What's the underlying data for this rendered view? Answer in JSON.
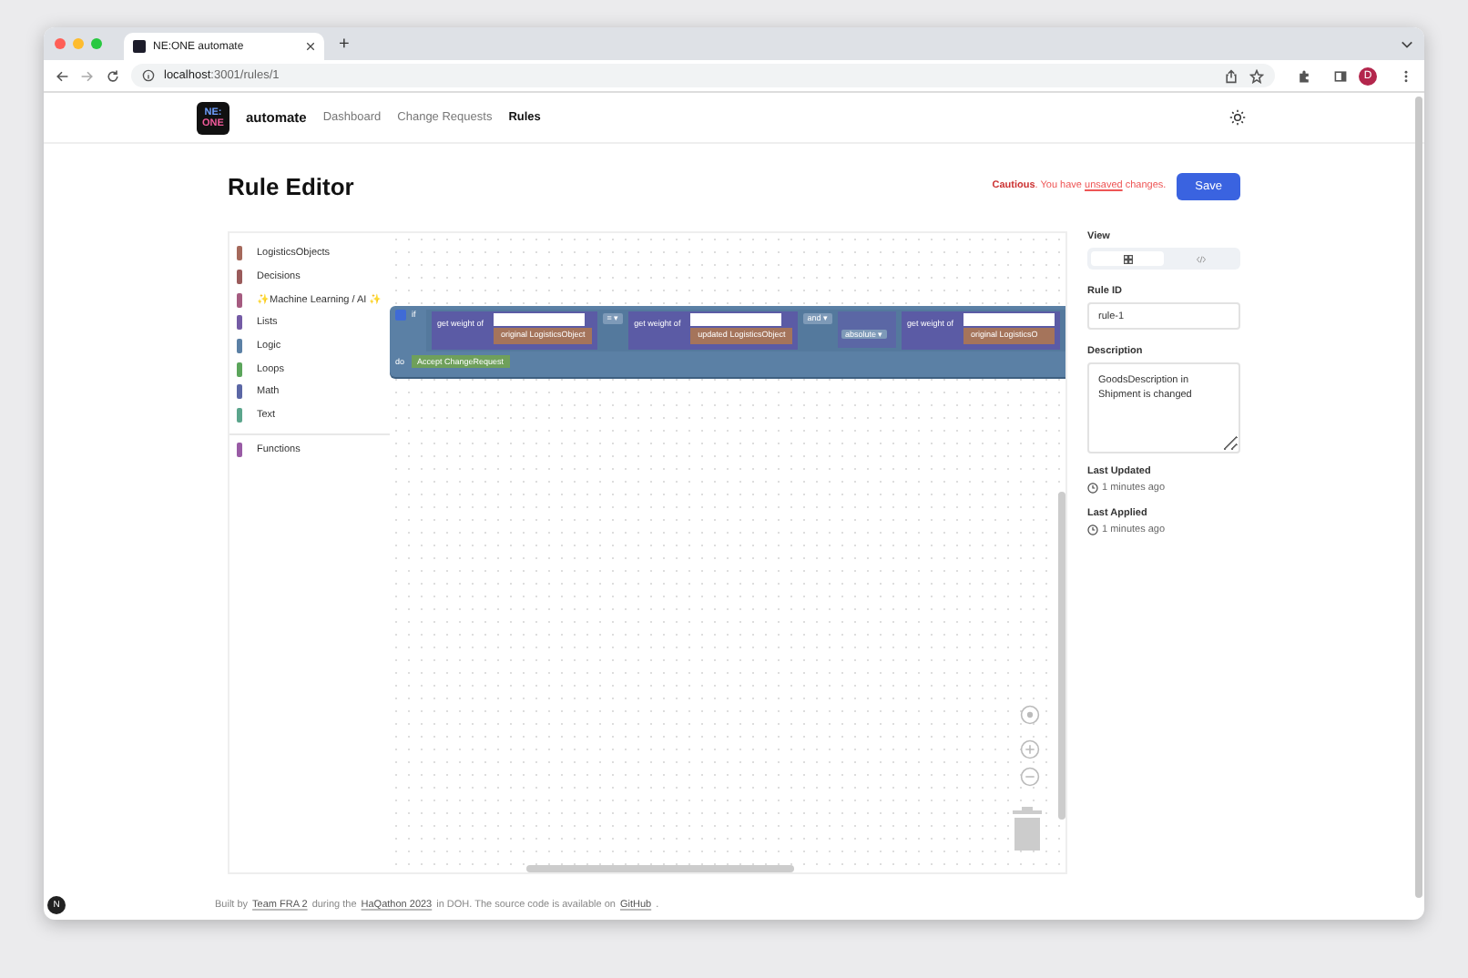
{
  "browser": {
    "tab_title": "NE:ONE automate",
    "new_tab": "+",
    "url_host": "localhost",
    "url_path": ":3001/rules/1",
    "profile": "D"
  },
  "app": {
    "logo": [
      "NE:",
      "ONE"
    ],
    "brand": "automate",
    "nav": [
      {
        "label": "Dashboard",
        "selected": false
      },
      {
        "label": "Change Requests",
        "selected": false
      },
      {
        "label": "Rules",
        "selected": true
      }
    ]
  },
  "header": {
    "title": "Rule Editor",
    "warning": {
      "label": "Cautious",
      "before": ". You have",
      "link": "unsaved",
      "after": "changes."
    },
    "save_button": "Save"
  },
  "toolbox": {
    "categories": [
      {
        "name": "LogisticsObjects",
        "color": "#a5695b"
      },
      {
        "name": "Decisions",
        "color": "#9a5b5b"
      },
      {
        "name": "✨Machine Learning / AI ✨",
        "color": "#a55b80"
      },
      {
        "name": "Lists",
        "color": "#745ba5"
      },
      {
        "name": "Logic",
        "color": "#5b80a5"
      },
      {
        "name": "Loops",
        "color": "#5ba55b"
      },
      {
        "name": "Math",
        "color": "#5b67a5"
      },
      {
        "name": "Text",
        "color": "#5ba58c"
      }
    ],
    "extra_categories": [
      {
        "name": "Functions",
        "color": "#995ba5"
      }
    ]
  },
  "blocks": {
    "if": "if",
    "do": "do",
    "getter_1": "get weight of",
    "object_1": "original LogisticsObject",
    "operator": "= ▾",
    "getter_2": "get weight of",
    "object_2": "updated LogisticsObject",
    "logic": "and ▾",
    "math": "absolute ▾",
    "getter_3": "get weight of",
    "object_3": "original LogisticsO",
    "action": "Accept ChangeRequest"
  },
  "panel": {
    "view_label": "View",
    "view_options": [
      {
        "kind": "blocks",
        "selected": true
      },
      {
        "kind": "code",
        "selected": false
      }
    ],
    "rule_id_label": "Rule ID",
    "rule_id": "rule-1",
    "description_label": "Description",
    "description": "GoodsDescription in Shipment is changed",
    "last_updated_label": "Last Updated",
    "last_updated": "1 minutes ago",
    "last_applied_label": "Last Applied",
    "last_applied": "1 minutes ago"
  },
  "footer": [
    {
      "kind": "text",
      "text": "Built by"
    },
    {
      "kind": "link",
      "text": "Team FRA 2"
    },
    {
      "kind": "text",
      "text": "during the"
    },
    {
      "kind": "link",
      "text": "HaQathon 2023"
    },
    {
      "kind": "text",
      "text": "in DOH. The source code is available on"
    },
    {
      "kind": "link",
      "text": "GitHub"
    },
    {
      "kind": "text",
      "text": "."
    }
  ],
  "corner_badge": "N"
}
